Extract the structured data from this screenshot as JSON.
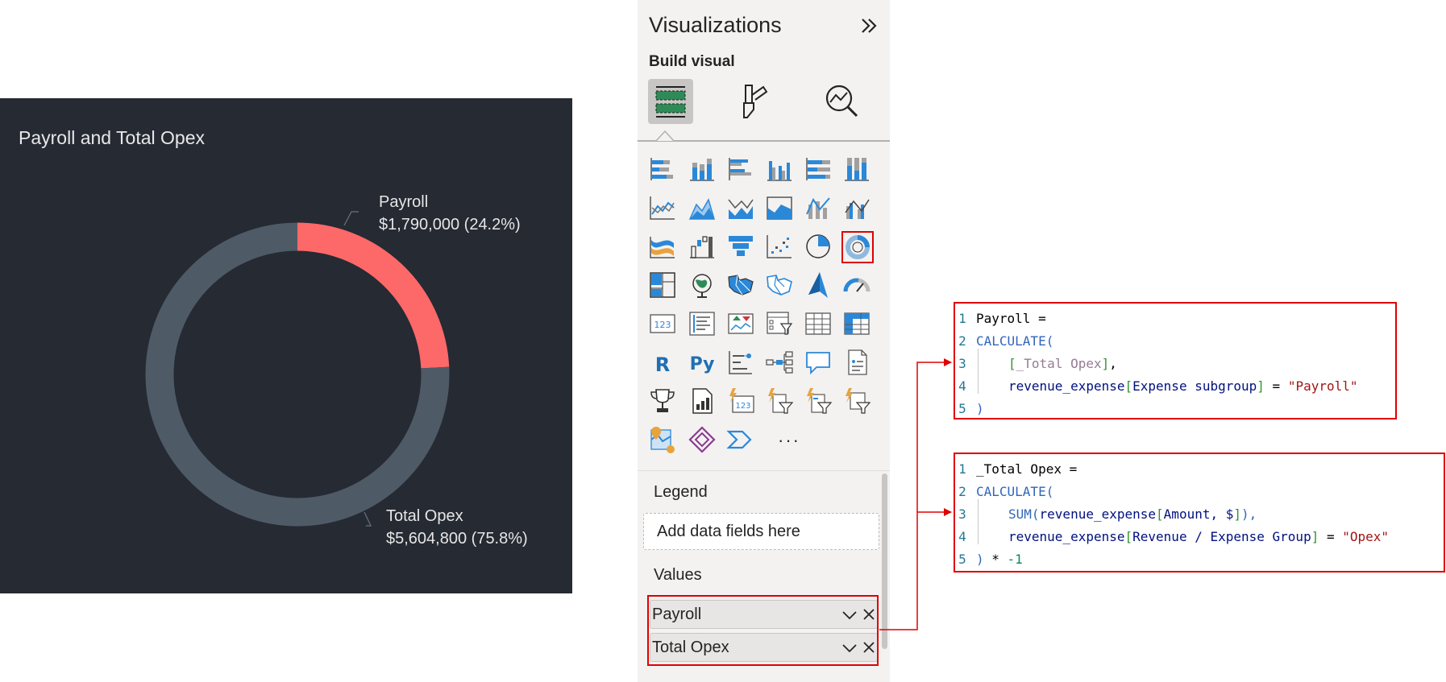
{
  "visual": {
    "title": "Payroll and Total Opex",
    "colors": {
      "background": "#252a33",
      "payroll": "#fd6968",
      "opex": "#4f5a67"
    },
    "labels": [
      {
        "name": "Payroll",
        "value": "$1,790,000 (24.2%)"
      },
      {
        "name": "Total Opex",
        "value": "$5,604,800 (75.8%)"
      }
    ]
  },
  "chart_data": {
    "type": "pie",
    "style": "donut",
    "title": "Payroll and Total Opex",
    "categories": [
      "Payroll",
      "Total Opex"
    ],
    "values": [
      1790000,
      5604800
    ],
    "percentages": [
      24.2,
      75.8
    ]
  },
  "pane": {
    "title": "Visualizations",
    "subtitle": "Build visual",
    "modes": [
      "build-visual-icon",
      "format-visual-icon",
      "analytics-icon"
    ],
    "more": "···",
    "legend_label": "Legend",
    "legend_placeholder": "Add data fields here",
    "values_label": "Values",
    "fields": [
      "Payroll",
      "Total Opex"
    ]
  },
  "code": {
    "payroll": {
      "l1": "Payroll =",
      "l2": "CALCULATE(",
      "l3a": "[",
      "l3b": "_Total Opex",
      "l3c": "]",
      "l3d": ",",
      "l4a": "revenue_expense",
      "l4b": "[",
      "l4c": "Expense subgroup",
      "l4d": "]",
      "l4e": " = ",
      "l4f": "\"Payroll\"",
      "l5": ")"
    },
    "opex": {
      "l1": "_Total Opex =",
      "l2": "CALCULATE(",
      "l3a": "SUM(",
      "l3b": "revenue_expense",
      "l3c": "[",
      "l3d": "Amount, $",
      "l3e": "]",
      "l3f": "),",
      "l4a": "revenue_expense",
      "l4b": "[",
      "l4c": "Revenue / Expense Group",
      "l4d": "]",
      "l4e": " = ",
      "l4f": "\"Opex\"",
      "l5a": ")",
      "l5b": " * ",
      "l5c": "-1"
    }
  }
}
